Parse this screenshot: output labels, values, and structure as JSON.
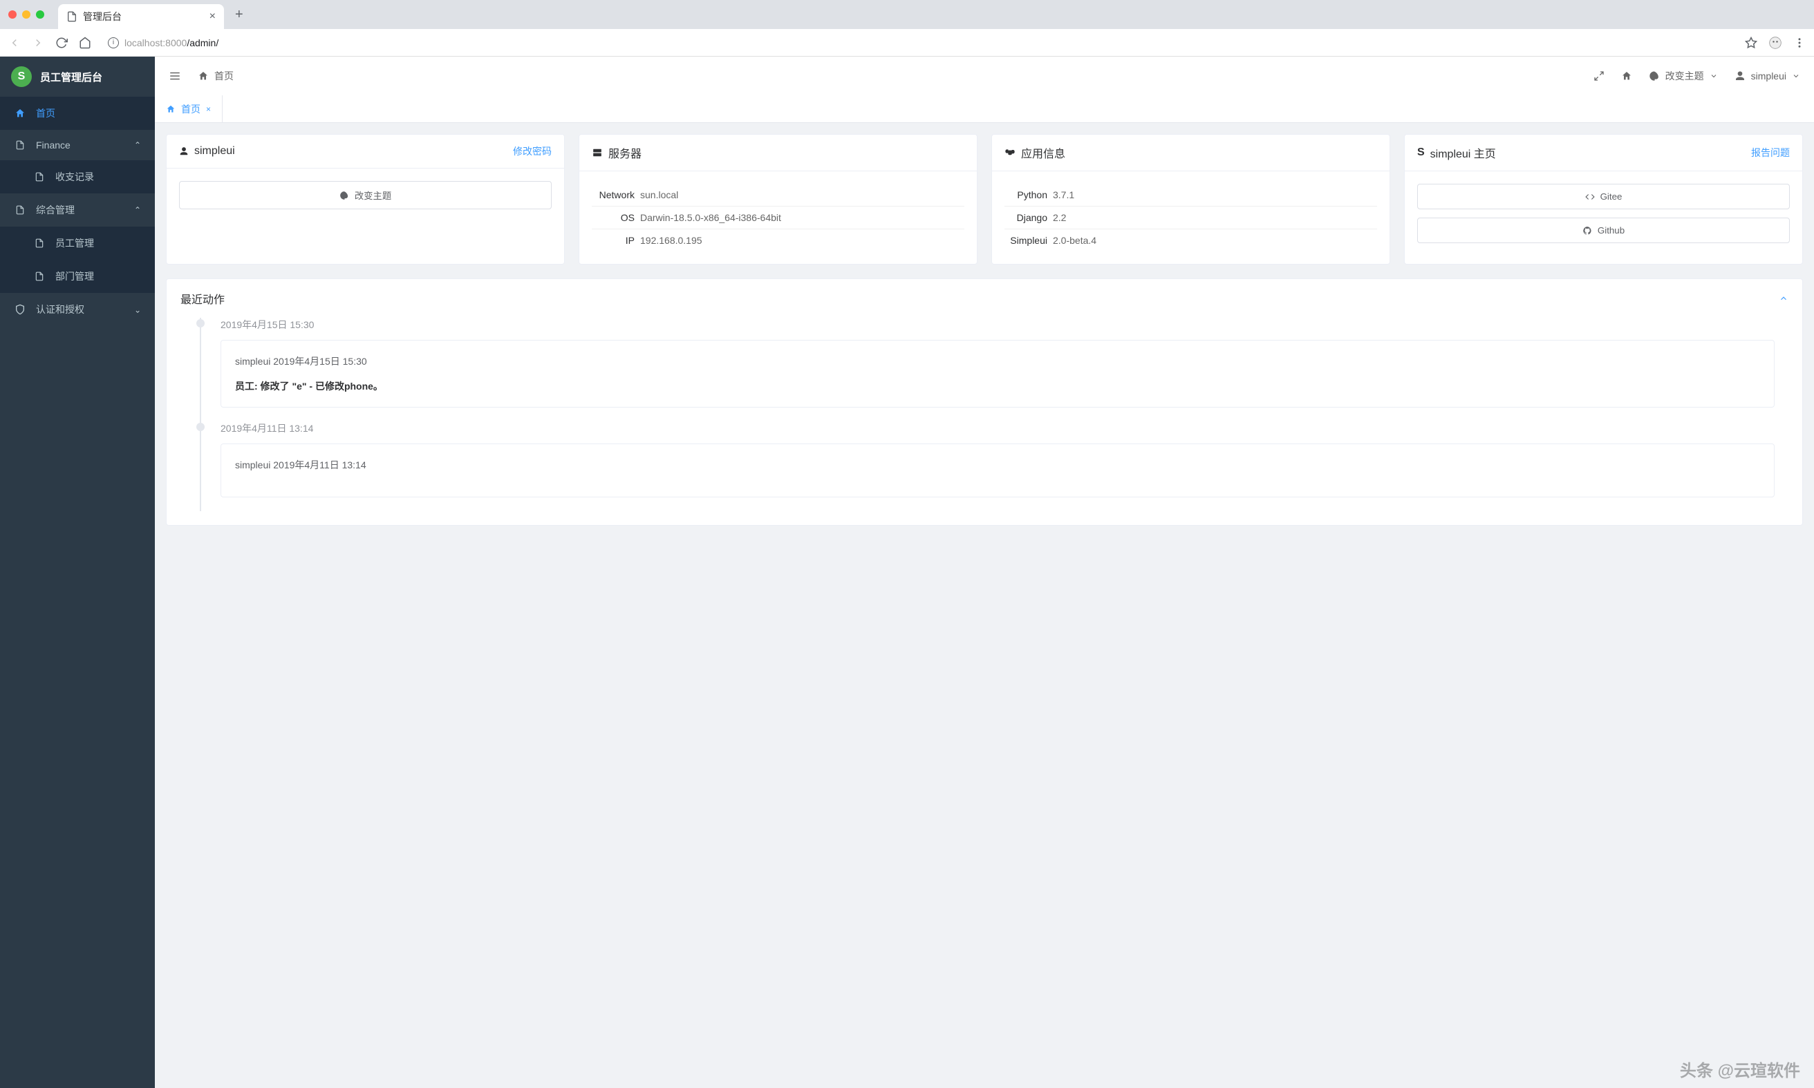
{
  "browser": {
    "tab_title": "管理后台",
    "url_host": "localhost",
    "url_port": ":8000",
    "url_path": "/admin/"
  },
  "sidebar": {
    "app_title": "员工管理后台",
    "logo_letter": "S",
    "items": [
      {
        "label": "首页"
      },
      {
        "label": "Finance"
      },
      {
        "label": "收支记录"
      },
      {
        "label": "综合管理"
      },
      {
        "label": "员工管理"
      },
      {
        "label": "部门管理"
      },
      {
        "label": "认证和授权"
      }
    ]
  },
  "topbar": {
    "home_label": "首页",
    "theme_label": "改变主题",
    "user_label": "simpleui"
  },
  "tab": {
    "label": "首页"
  },
  "cards": {
    "user": {
      "title": "simpleui",
      "link": "修改密码",
      "theme_btn": "改变主题"
    },
    "server": {
      "title": "服务器",
      "rows": [
        {
          "label": "Network",
          "value": "sun.local"
        },
        {
          "label": "OS",
          "value": "Darwin-18.5.0-x86_64-i386-64bit"
        },
        {
          "label": "IP",
          "value": "192.168.0.195"
        }
      ]
    },
    "app_info": {
      "title": "应用信息",
      "rows": [
        {
          "label": "Python",
          "value": "3.7.1"
        },
        {
          "label": "Django",
          "value": "2.2"
        },
        {
          "label": "Simpleui",
          "value": "2.0-beta.4"
        }
      ]
    },
    "homepage": {
      "title": "simpleui 主页",
      "link": "报告问题",
      "buttons": [
        {
          "label": "Gitee"
        },
        {
          "label": "Github"
        }
      ]
    }
  },
  "recent": {
    "title": "最近动作",
    "items": [
      {
        "timestamp": "2019年4月15日 15:30",
        "meta": "simpleui 2019年4月15日 15:30",
        "action_prefix": "员工: 修改了 \"e\" - 已修改phone。"
      },
      {
        "timestamp": "2019年4月11日 13:14",
        "meta": "simpleui 2019年4月11日 13:14",
        "action_prefix": ""
      }
    ]
  },
  "watermark": "头条 @云瑄软件"
}
